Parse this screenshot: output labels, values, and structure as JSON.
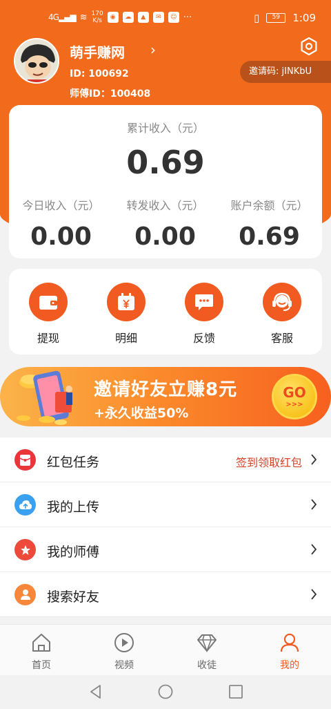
{
  "status_bar": {
    "network": "4G",
    "speed_top": "170",
    "speed_bottom": "K/s",
    "more": "···",
    "battery": "59",
    "time": "1:09"
  },
  "profile": {
    "nickname": "萌手赚网",
    "nick_arrow": "›",
    "user_id": "ID: 100692",
    "master_id": "师傅ID：100408",
    "invite_code": "邀请码: jINKbU"
  },
  "income": {
    "total_label": "累计收入（元）",
    "total_value": "0.69",
    "today_label": "今日收入（元）",
    "today_value": "0.00",
    "forward_label": "转发收入（元）",
    "forward_value": "0.00",
    "balance_label": "账户余额（元）",
    "balance_value": "0.69"
  },
  "actions": {
    "withdraw": "提现",
    "detail": "明细",
    "feedback": "反馈",
    "service": "客服"
  },
  "banner": {
    "title": "邀请好友立赚8元",
    "subtitle": "+永久收益50%",
    "go": "GO",
    "go_arrows": ">>>"
  },
  "menu": {
    "redpacket": "红包任务",
    "redpacket_extra": "签到领取红包",
    "upload": "我的上传",
    "master": "我的师傅",
    "search": "搜索好友"
  },
  "tabs": {
    "home": "首页",
    "video": "视频",
    "recruit": "收徒",
    "mine": "我的"
  },
  "colors": {
    "brand": "#f26a1b",
    "accent": "#f15b22",
    "badge_red": "#d34328"
  }
}
